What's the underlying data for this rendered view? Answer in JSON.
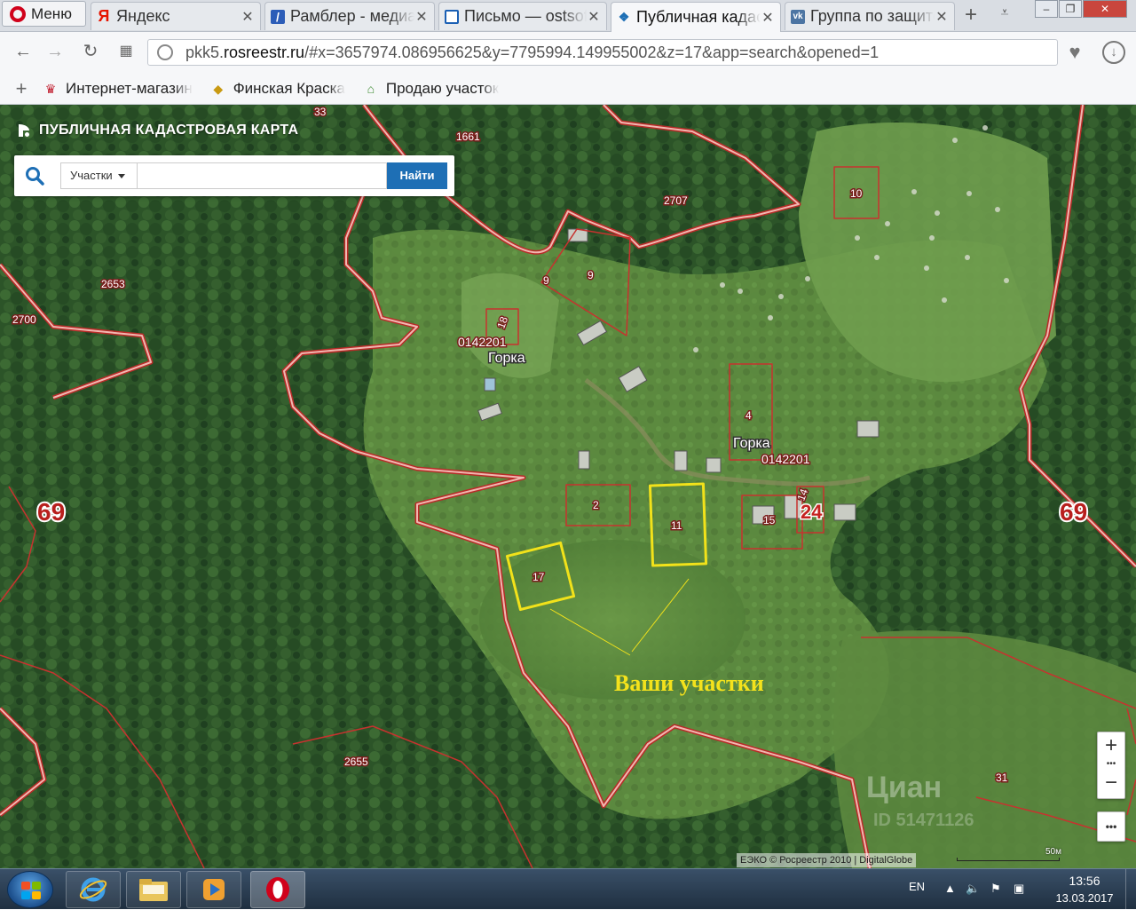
{
  "browser": {
    "menu_label": "Меню",
    "tabs": [
      {
        "label": "Яндекс",
        "icon": "yandex-icon"
      },
      {
        "label": "Рамблер - медиапортал",
        "icon": "rambler-icon"
      },
      {
        "label": "Письмо — ostsoft@mail.ru",
        "icon": "mail-icon"
      },
      {
        "label": "Публичная кадастровая карта",
        "icon": "rosreestr-icon",
        "active": true
      },
      {
        "label": "Группа по защите",
        "icon": "vk-icon"
      }
    ],
    "address": {
      "prefix": "pkk5.",
      "host": "rosreestr.ru",
      "path": "/#x=3657974.086956625&y=7795994.149955002&z=17&app=search&opened=1"
    },
    "bookmarks": [
      {
        "label": "Интернет-магазин",
        "icon": "dress-icon"
      },
      {
        "label": "Финская Краска",
        "icon": "paint-icon"
      },
      {
        "label": "Продаю участок",
        "icon": "land-icon"
      }
    ]
  },
  "map_app": {
    "title": "ПУБЛИЧНАЯ КАДАСТРОВАЯ КАРТА",
    "search": {
      "type_label": "Участки",
      "placeholder": "",
      "button_label": "Найти"
    },
    "zoom_in": "+",
    "zoom_out": "−",
    "more": "•••",
    "attribution": "ЕЭКО © Росреестр 2010 | DigitalGlobe",
    "scale_label": "50м"
  },
  "map_labels": {
    "q33": "33",
    "q1661": "1661",
    "q2707": "2707",
    "q10": "10",
    "q2653": "2653",
    "q2700": "2700",
    "p9a": "9",
    "p9b": "9",
    "p18": "18",
    "block_left": "0142201",
    "village_left": "Горка",
    "p4": "4",
    "village_right": "Горка",
    "block_right": "0142201",
    "p2": "2",
    "p11": "11",
    "p15": "15",
    "p14": "14",
    "p24": "24",
    "p17": "17",
    "kv69_left": "69",
    "kv69_right": "69",
    "q2655": "2655",
    "q31": "31",
    "annotation": "Ваши участки",
    "watermark": "Циан",
    "watermark_id": "ID 51471126"
  },
  "colors": {
    "parcel_border": "#c7322f",
    "highlight": "#f2e21a",
    "annotation": "#f4e21c",
    "search_button": "#1e6fb5"
  },
  "taskbar": {
    "apps": [
      "explorer-icon",
      "ie-icon",
      "folder-icon",
      "media-player-icon",
      "opera-icon"
    ],
    "lang": "EN",
    "time": "13:56",
    "date": "13.03.2017"
  }
}
